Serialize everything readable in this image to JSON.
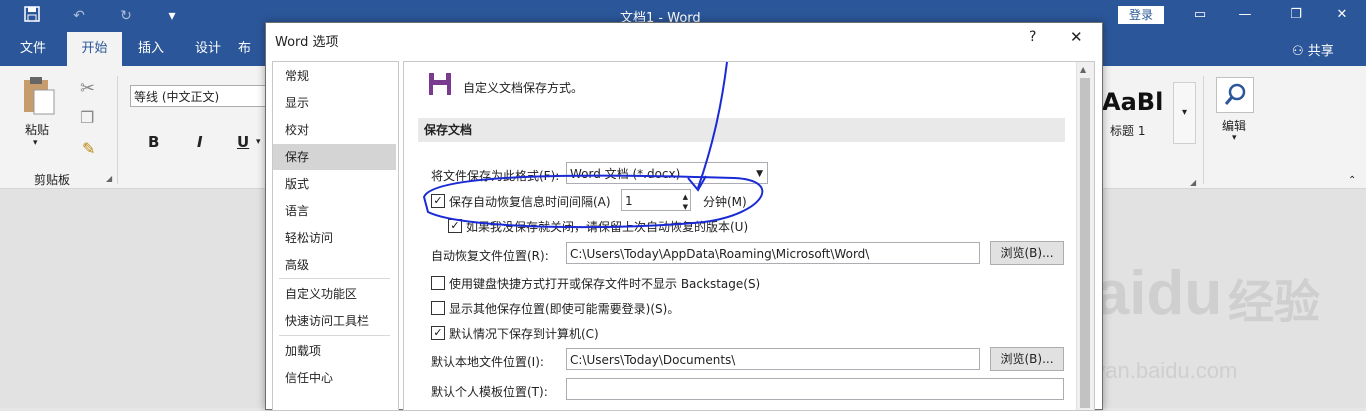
{
  "app": {
    "title": "文档1  -  Word",
    "login_label": "登录",
    "share_label": "共享",
    "qat": {
      "save_icon": "save-icon",
      "undo_icon": "undo-icon",
      "redo_icon": "redo-icon",
      "customize_icon": "customize-qat-icon"
    },
    "window": {
      "restore": "restore-icon",
      "minimize": "minimize-icon",
      "maximize": "maximize-icon",
      "close": "close-icon"
    }
  },
  "ribbon": {
    "tabs": [
      {
        "label": "文件"
      },
      {
        "label": "开始"
      },
      {
        "label": "插入"
      },
      {
        "label": "设计"
      },
      {
        "label": "布"
      }
    ],
    "clipboard": {
      "paste_label": "粘贴",
      "group_label": "剪贴板"
    },
    "font": {
      "font_name": "等线 (中文正文)",
      "bold": "B",
      "italic": "I",
      "underline": "U"
    },
    "styles": {
      "preview": "AaBl",
      "name": "标题 1"
    },
    "editing": {
      "label": "编辑"
    }
  },
  "dialog": {
    "title": "Word 选项",
    "help": "?",
    "close": "✕",
    "nav": [
      {
        "label": "常规"
      },
      {
        "label": "显示"
      },
      {
        "label": "校对"
      },
      {
        "label": "保存"
      },
      {
        "label": "版式"
      },
      {
        "label": "语言"
      },
      {
        "label": "轻松访问"
      },
      {
        "label": "高级"
      },
      {
        "label": "自定义功能区"
      },
      {
        "label": "快速访问工具栏"
      },
      {
        "label": "加载项"
      },
      {
        "label": "信任中心"
      }
    ],
    "header_text": "自定义文档保存方式。",
    "section_title": "保存文档",
    "save_format_label": "将文件保存为此格式(F):",
    "save_format_value": "Word 文档 (*.docx)",
    "autorecover_label": "保存自动恢复信息时间间隔(A)",
    "autorecover_value": "1",
    "minutes_label": "分钟(M)",
    "keep_last_label": "如果我没保存就关闭，请保留上次自动恢复的版本(U)",
    "autorecover_location_label": "自动恢复文件位置(R):",
    "autorecover_location_value": "C:\\Users\\Today\\AppData\\Roaming\\Microsoft\\Word\\",
    "browse_label": "浏览(B)...",
    "no_backstage_label": "使用键盘快捷方式打开或保存文件时不显示 Backstage(S)",
    "show_other_label": "显示其他保存位置(即使可能需要登录)(S)。",
    "save_local_label": "默认情况下保存到计算机(C)",
    "default_local_label": "默认本地文件位置(I):",
    "default_local_value": "C:\\Users\\Today\\Documents\\",
    "default_template_label": "默认个人模板位置(T):",
    "default_template_value": "",
    "checkboxes": {
      "autorecover": true,
      "keep_last": true,
      "no_backstage": false,
      "show_other": false,
      "save_local": true
    }
  },
  "watermark": {
    "brand": "Baidu",
    "brand_cn": "经验",
    "url": "jingyan.baidu.com"
  },
  "colors": {
    "accent": "#2b579a",
    "annotation": "#1a2bd6"
  }
}
